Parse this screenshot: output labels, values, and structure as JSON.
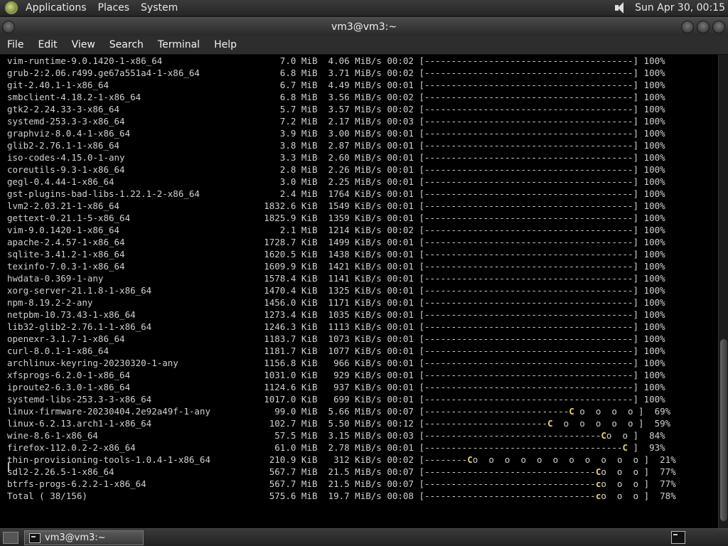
{
  "top_panel": {
    "menus": [
      "Applications",
      "Places",
      "System"
    ],
    "clock": "Sun Apr 30, 00:15"
  },
  "window": {
    "title": "vm3@vm3:~"
  },
  "menubar": [
    "File",
    "Edit",
    "View",
    "Search",
    "Terminal",
    "Help"
  ],
  "terminal": {
    "lines": [
      "vim-runtime-9.0.1420-1-x86_64                      7.0 MiB  4.06 MiB/s 00:02 [---------------------------------------] 100%",
      "grub-2:2.06.r499.ge67a551a4-1-x86_64               6.8 MiB  3.71 MiB/s 00:02 [---------------------------------------] 100%",
      "git-2.40.1-1-x86_64                                6.7 MiB  4.49 MiB/s 00:01 [---------------------------------------] 100%",
      "smbclient-4.18.2-1-x86_64                          6.8 MiB  3.56 MiB/s 00:02 [---------------------------------------] 100%",
      "gtk2-2.24.33-3-x86_64                              5.7 MiB  3.57 MiB/s 00:02 [---------------------------------------] 100%",
      "systemd-253.3-3-x86_64                             7.2 MiB  2.17 MiB/s 00:03 [---------------------------------------] 100%",
      "graphviz-8.0.4-1-x86_64                            3.9 MiB  3.00 MiB/s 00:01 [---------------------------------------] 100%",
      "glib2-2.76.1-1-x86_64                              3.8 MiB  2.87 MiB/s 00:01 [---------------------------------------] 100%",
      "iso-codes-4.15.0-1-any                             3.3 MiB  2.60 MiB/s 00:01 [---------------------------------------] 100%",
      "coreutils-9.3-1-x86_64                             2.8 MiB  2.26 MiB/s 00:01 [---------------------------------------] 100%",
      "gegl-0.4.44-1-x86_64                               3.0 MiB  2.25 MiB/s 00:01 [---------------------------------------] 100%",
      "gst-plugins-bad-libs-1.22.1-2-x86_64               2.4 MiB  1764 KiB/s 00:01 [---------------------------------------] 100%",
      "lvm2-2.03.21-1-x86_64                           1832.6 KiB  1549 KiB/s 00:01 [---------------------------------------] 100%",
      "gettext-0.21.1-5-x86_64                         1825.9 KiB  1359 KiB/s 00:01 [---------------------------------------] 100%",
      "vim-9.0.1420-1-x86_64                              2.1 MiB  1214 KiB/s 00:02 [---------------------------------------] 100%",
      "apache-2.4.57-1-x86_64                          1728.7 KiB  1499 KiB/s 00:01 [---------------------------------------] 100%",
      "sqlite-3.41.2-1-x86_64                          1620.5 KiB  1438 KiB/s 00:01 [---------------------------------------] 100%",
      "texinfo-7.0.3-1-x86_64                          1609.9 KiB  1421 KiB/s 00:01 [---------------------------------------] 100%",
      "hwdata-0.369-1-any                              1578.4 KiB  1141 KiB/s 00:01 [---------------------------------------] 100%",
      "xorg-server-21.1.8-1-x86_64                     1470.4 KiB  1325 KiB/s 00:01 [---------------------------------------] 100%",
      "npm-8.19.2-2-any                                1456.0 KiB  1171 KiB/s 00:01 [---------------------------------------] 100%",
      "netpbm-10.73.43-1-x86_64                        1273.4 KiB  1035 KiB/s 00:01 [---------------------------------------] 100%",
      "lib32-glib2-2.76.1-1-x86_64                     1246.3 KiB  1113 KiB/s 00:01 [---------------------------------------] 100%",
      "openexr-3.1.7-1-x86_64                          1183.7 KiB  1073 KiB/s 00:01 [---------------------------------------] 100%",
      "curl-8.0.1-1-x86_64                             1181.7 KiB  1077 KiB/s 00:01 [---------------------------------------] 100%",
      "archlinux-keyring-20230320-1-any                1156.8 KiB   966 KiB/s 00:01 [---------------------------------------] 100%",
      "xfsprogs-6.2.0-1-x86_64                         1031.0 KiB   929 KiB/s 00:01 [---------------------------------------] 100%",
      "iproute2-6.3.0-1-x86_64                         1124.6 KiB   937 KiB/s 00:01 [---------------------------------------] 100%",
      "systemd-libs-253.3-3-x86_64                     1017.0 KiB   699 KiB/s 00:01 [---------------------------------------] 100%",
      "linux-firmware-20230404.2e92a49f-1-any            99.0 MiB  5.66 MiB/s 00:07 [---------------------------C o  o  o  o ]  69%",
      "linux-6.2.13.arch1-1-x86_64                      102.7 MiB  5.50 MiB/s 00:12 [-----------------------C  o  o  o  o  o ]  59%",
      "wine-8.6-1-x86_64                                 57.5 MiB  3.15 MiB/s 00:03 [---------------------------------Co  o ]  84%",
      "firefox-112.0.2-2-x86_64                          61.0 MiB  2.78 MiB/s 00:01 [-------------------------------------C ]  93%",
      "thin-provisioning-tools-1.0.4-1-x86_64           210.9 KiB   312 KiB/s 00:02 [--------Co  o  o  o  o  o  o  o  o  o  o ]  21%",
      "sdl2-2.26.5-1-x86_64                             567.7 MiB  21.5 MiB/s 00:07 [--------------------------------Co  o  o ]  77%",
      "btrfs-progs-6.2.2-1-x86_64                       567.7 MiB  21.5 MiB/s 00:07 [--------------------------------co  o  o ]  77%",
      "Total ( 38/156)                                  575.6 MiB  19.7 MiB/s 00:08 [--------------------------------co  o  o ]  78%"
    ]
  },
  "taskbar": {
    "window_button": "vm3@vm3:~"
  },
  "icons": {
    "logo": "distro-logo-icon",
    "volume": "volume-icon",
    "terminal": "terminal-icon"
  }
}
